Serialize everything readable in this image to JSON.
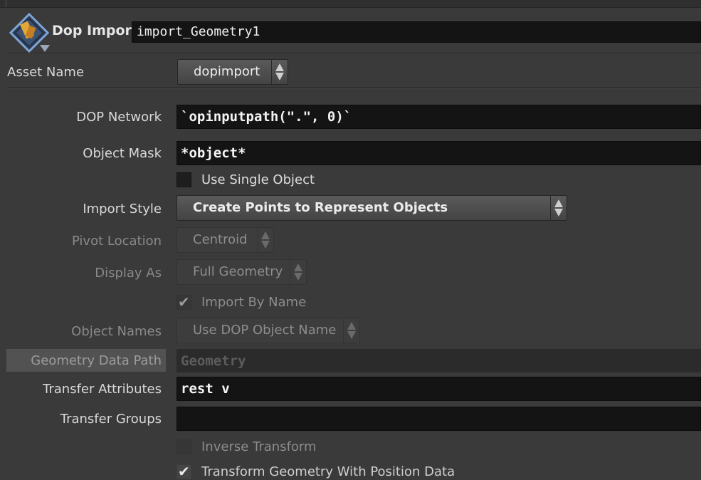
{
  "header": {
    "node_type": "Dop Import",
    "node_name": "import_Geometry1",
    "icon": "dop-import-node-icon"
  },
  "asset": {
    "label": "Asset Name",
    "value": "dopimport"
  },
  "params": {
    "dop_network": {
      "label": "DOP Network",
      "value": "`opinputpath(\".\", 0)`"
    },
    "object_mask": {
      "label": "Object Mask",
      "value": "*object*"
    },
    "use_single_object": {
      "label": "Use Single Object",
      "checked": false
    },
    "import_style": {
      "label": "Import Style",
      "value": "Create Points to Represent Objects"
    },
    "pivot_location": {
      "label": "Pivot Location",
      "value": "Centroid"
    },
    "display_as": {
      "label": "Display As",
      "value": "Full Geometry"
    },
    "import_by_name": {
      "label": "Import By Name",
      "checked": true
    },
    "object_names": {
      "label": "Object Names",
      "value": "Use DOP Object Name"
    },
    "geometry_data_path": {
      "label": "Geometry Data Path",
      "value": "Geometry"
    },
    "transfer_attributes": {
      "label": "Transfer Attributes",
      "value": "rest v"
    },
    "transfer_groups": {
      "label": "Transfer Groups",
      "value": ""
    },
    "inverse_transform": {
      "label": "Inverse Transform",
      "checked": false
    },
    "transform_geometry": {
      "label": "Transform Geometry With Position Data",
      "checked": true
    }
  }
}
